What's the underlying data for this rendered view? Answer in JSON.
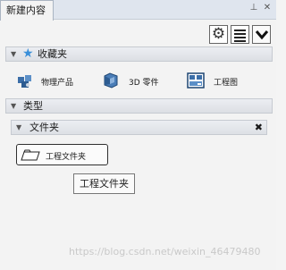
{
  "tab": {
    "title": "新建内容",
    "pin": "⊥",
    "close": "✕"
  },
  "favorites": {
    "title": "收藏夹",
    "items": [
      {
        "label": "物理产品",
        "icon": "physical-product-icon"
      },
      {
        "label": "3D 零件",
        "icon": "3d-part-icon"
      },
      {
        "label": "工程图",
        "icon": "drawing-icon"
      }
    ]
  },
  "types": {
    "title": "类型"
  },
  "folders": {
    "title": "文件夹",
    "close": "✖",
    "button_label": "工程文件夹"
  },
  "tooltip": {
    "text": "工程文件夹"
  },
  "watermark": "https://blog.csdn.net/weixin_46479480",
  "colors": {
    "star": "#3a8fd9",
    "tab_bg": "#dfe5ee",
    "panel_bg": "#f3f3f3"
  }
}
